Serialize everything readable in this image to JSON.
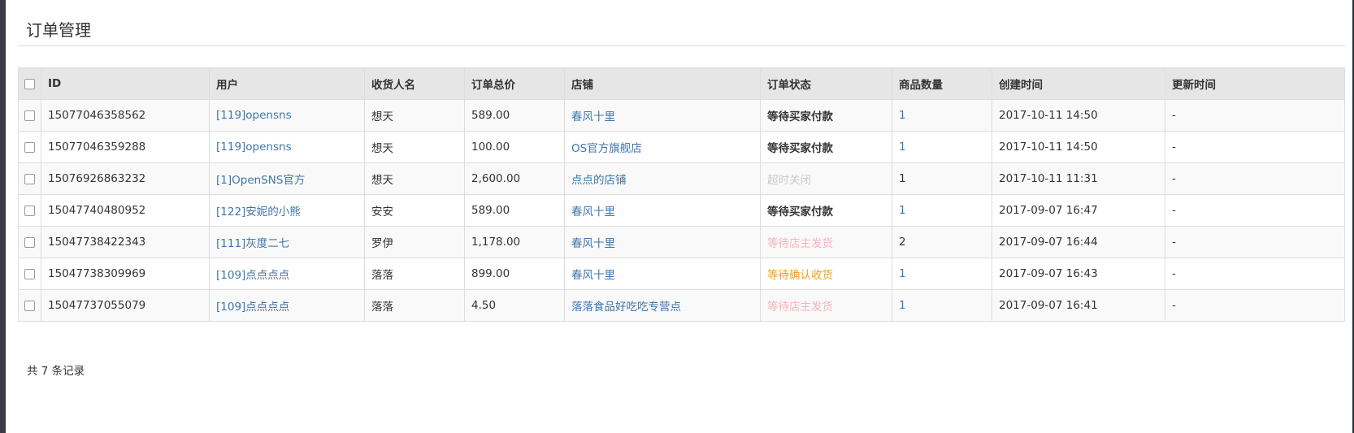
{
  "page": {
    "title": "订单管理"
  },
  "table": {
    "headers": [
      "ID",
      "用户",
      "收货人名",
      "订单总价",
      "店铺",
      "订单状态",
      "商品数量",
      "创建时间",
      "更新时间"
    ],
    "rows": [
      {
        "id": "15077046358562",
        "user": "[119]opensns",
        "receiver": "想天",
        "total": "589.00",
        "store": "春风十里",
        "status": "等待买家付款",
        "qty": "1",
        "created": "2017-10-11 14:50",
        "updated": "-"
      },
      {
        "id": "15077046359288",
        "user": "[119]opensns",
        "receiver": "想天",
        "total": "100.00",
        "store": "OS官方旗舰店",
        "status": "等待买家付款",
        "qty": "1",
        "created": "2017-10-11 14:50",
        "updated": "-"
      },
      {
        "id": "15076926863232",
        "user": "[1]OpenSNS官方",
        "receiver": "想天",
        "total": "2,600.00",
        "store": "点点的店铺",
        "status": "超时关闭",
        "qty": "1",
        "created": "2017-10-11 11:31",
        "updated": "-"
      },
      {
        "id": "15047740480952",
        "user": "[122]安妮的小熊",
        "receiver": "安安",
        "total": "589.00",
        "store": "春风十里",
        "status": "等待买家付款",
        "qty": "1",
        "created": "2017-09-07 16:47",
        "updated": "-"
      },
      {
        "id": "15047738422343",
        "user": "[111]灰度二七",
        "receiver": "罗伊",
        "total": "1,178.00",
        "store": "春风十里",
        "status": "等待店主发货",
        "qty": "2",
        "created": "2017-09-07 16:44",
        "updated": "-"
      },
      {
        "id": "15047738309969",
        "user": "[109]点点点点",
        "receiver": "落落",
        "total": "899.00",
        "store": "春风十里",
        "status": "等待确认收货",
        "qty": "1",
        "created": "2017-09-07 16:43",
        "updated": "-"
      },
      {
        "id": "15047737055079",
        "user": "[109]点点点点",
        "receiver": "落落",
        "total": "4.50",
        "store": "落落食品好吃吃专营点",
        "status": "等待店主发货",
        "qty": "1",
        "created": "2017-09-07 16:41",
        "updated": "-"
      }
    ]
  },
  "footer": {
    "count_text": "共 7 条记录"
  },
  "colors": {
    "link": "#3f75ad",
    "status_awaiting_payment": "#333333",
    "status_timeout_closed": "#c9c9c9",
    "status_awaiting_shipment": "#f4b4bd",
    "status_awaiting_receipt": "#f0a020"
  }
}
